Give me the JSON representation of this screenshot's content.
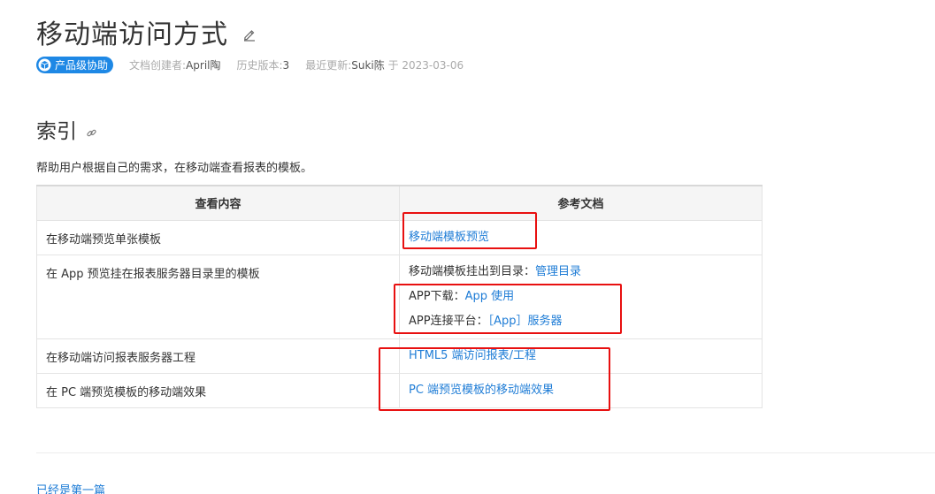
{
  "doc": {
    "title": "移动端访问方式",
    "badge": "产品级协助",
    "meta": {
      "creator_label": "文档创建者:",
      "creator": "April陶",
      "version_label": "历史版本:",
      "version": "3",
      "updated_label": "最近更新:",
      "updated_by": "Suki陈",
      "updated_on": "于 2023-03-06"
    }
  },
  "section": {
    "heading": "索引",
    "intro": "帮助用户根据自己的需求，在移动端查看报表的模板。"
  },
  "table": {
    "headers": [
      "查看内容",
      "参考文档"
    ],
    "rows": [
      {
        "content": "在移动端预览单张模板",
        "refs": [
          {
            "label": "",
            "link": "移动端模板预览"
          }
        ]
      },
      {
        "content": "在 App 预览挂在报表服务器目录里的模板",
        "refs": [
          {
            "label": "移动端模板挂出到目录：",
            "link": "管理目录"
          },
          {
            "label": "APP下载：",
            "link": "App 使用"
          },
          {
            "label": "APP连接平台：",
            "link": "［App］服务器"
          }
        ]
      },
      {
        "content": "在移动端访问报表服务器工程",
        "refs": [
          {
            "label": "",
            "link": "HTML5 端访问报表/工程"
          }
        ]
      },
      {
        "content": "在 PC 端预览模板的移动端效果",
        "refs": [
          {
            "label": "",
            "link": "PC 端预览模板的移动端效果"
          }
        ]
      }
    ]
  },
  "footer": {
    "prev_link": "已经是第一篇"
  },
  "colors": {
    "link": "#1e7cd6",
    "badge": "#1e88e5",
    "highlight_box": "#e81010"
  }
}
